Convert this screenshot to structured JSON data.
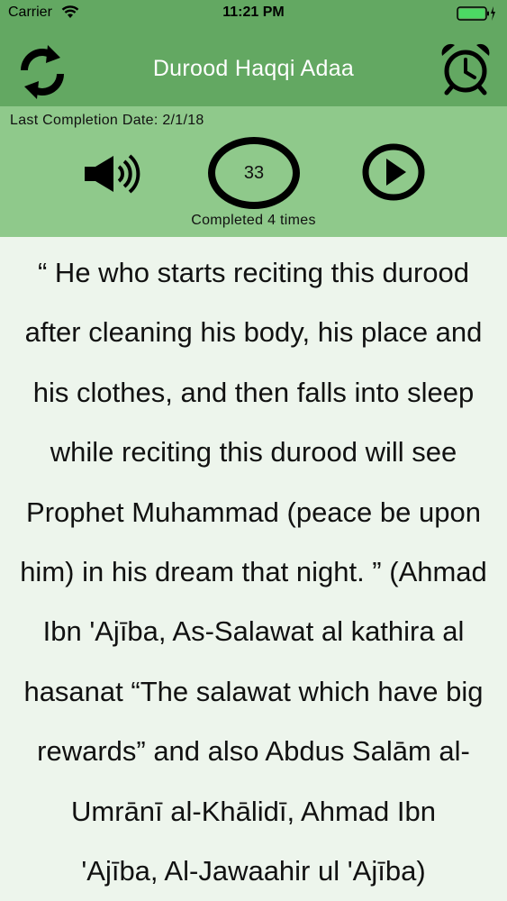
{
  "status_bar": {
    "carrier": "Carrier",
    "time": "11:21 PM"
  },
  "nav": {
    "title": "Durood Haqqi Adaa",
    "left_icon": "refresh-icon",
    "right_icon": "alarm-clock-icon"
  },
  "panel": {
    "last_completion": "Last Completion Date: 2/1/18",
    "counter": "33",
    "completed": "Completed 4 times",
    "icons": [
      "speaker-icon",
      "play-icon"
    ]
  },
  "content": {
    "lines": [
      "“ He who starts reciting this durood",
      "after cleaning his body, his place and",
      "his clothes, and then falls into sleep",
      "while reciting this durood will see",
      "Prophet Muhammad (peace be upon",
      "him) in his dream that night. ” (Ahmad",
      "Ibn 'Ajība, As-Salawat al kathira al",
      "hasanat “The salawat which have big",
      "rewards” and also Abdus Salām al-",
      "Umrānī al-Khālidī, Ahmad Ibn",
      "'Ajība, Al-Jawaahir ul 'Ajība)"
    ]
  },
  "colors": {
    "header_green": "#63a862",
    "panel_green": "#8fc98b",
    "background": "#edf5ec"
  }
}
